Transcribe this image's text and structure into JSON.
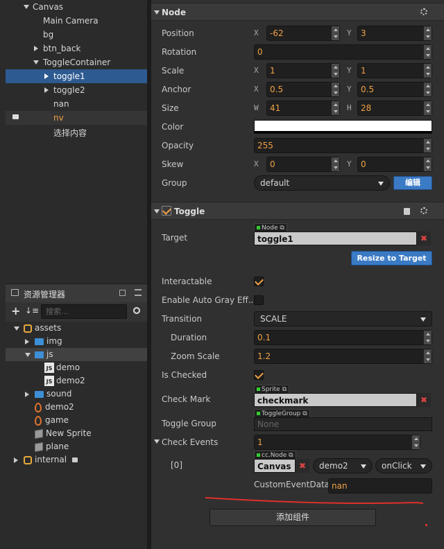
{
  "hierarchy": {
    "nodes": [
      {
        "label": "Canvas",
        "expand": "down"
      },
      {
        "label": "Main Camera",
        "expand": ""
      },
      {
        "label": "bg",
        "expand": ""
      },
      {
        "label": "btn_back",
        "expand": "right"
      },
      {
        "label": "ToggleContainer",
        "expand": "down"
      },
      {
        "label": "toggle1",
        "expand": "right",
        "selected": true
      },
      {
        "label": "toggle2",
        "expand": "right"
      },
      {
        "label": "nan",
        "expand": ""
      },
      {
        "label": "nv",
        "expand": "",
        "locked": true
      },
      {
        "label": "选择内容",
        "expand": ""
      }
    ]
  },
  "assets": {
    "title": "资源管理器",
    "search_placeholder": "搜索...",
    "items": [
      {
        "label": "assets",
        "icon": "package-icon"
      },
      {
        "label": "img",
        "icon": "folder-icon"
      },
      {
        "label": "js",
        "icon": "folder-icon"
      },
      {
        "label": "demo",
        "icon": "js-file-icon"
      },
      {
        "label": "demo2",
        "icon": "js-file-icon"
      },
      {
        "label": "sound",
        "icon": "folder-icon"
      },
      {
        "label": "demo2",
        "icon": "scene-fire-icon"
      },
      {
        "label": "game",
        "icon": "scene-fire-icon"
      },
      {
        "label": "New Sprite",
        "icon": "prefab-cube-icon"
      },
      {
        "label": "plane",
        "icon": "prefab-cube-icon"
      },
      {
        "label": "internal",
        "icon": "package-icon"
      }
    ]
  },
  "node": {
    "title": "Node",
    "position": {
      "label": "Position",
      "x": "-62",
      "y": "3"
    },
    "rotation": {
      "label": "Rotation",
      "value": "0"
    },
    "scale": {
      "label": "Scale",
      "x": "1",
      "y": "1"
    },
    "anchor": {
      "label": "Anchor",
      "x": "0.5",
      "y": "0.5"
    },
    "size": {
      "label": "Size",
      "w": "41",
      "h": "28"
    },
    "color": {
      "label": "Color",
      "value": "#ffffff"
    },
    "opacity": {
      "label": "Opacity",
      "value": "255"
    },
    "skew": {
      "label": "Skew",
      "x": "0",
      "y": "0"
    },
    "group": {
      "label": "Group",
      "value": "default",
      "edit": "编辑"
    },
    "axis": {
      "x": "X",
      "y": "Y",
      "w": "W",
      "h": "H"
    }
  },
  "toggle": {
    "title": "Toggle",
    "target": {
      "label": "Target",
      "tag": "Node",
      "value": "toggle1"
    },
    "resize_button": "Resize to Target",
    "interactable": {
      "label": "Interactable",
      "checked": true
    },
    "auto_gray": {
      "label": "Enable Auto Gray Eff...",
      "checked": false
    },
    "transition": {
      "label": "Transition",
      "value": "SCALE"
    },
    "duration": {
      "label": "Duration",
      "value": "0.1"
    },
    "zoom_scale": {
      "label": "Zoom Scale",
      "value": "1.2"
    },
    "is_checked": {
      "label": "Is Checked",
      "checked": true
    },
    "check_mark": {
      "label": "Check Mark",
      "tag": "Sprite",
      "value": "checkmark"
    },
    "toggle_group": {
      "label": "Toggle Group",
      "tag": "ToggleGroup",
      "placeholder": "None"
    },
    "check_events": {
      "label": "Check Events",
      "count": "1"
    },
    "event0": {
      "index": "[0]",
      "tag": "cc.Node",
      "target": "Canvas",
      "component": "demo2",
      "handler": "onClick"
    },
    "custom_event_data": {
      "label": "CustomEventData",
      "value": "nan"
    }
  },
  "add_component": "添加组件",
  "colors": {
    "accent": "#f0a245",
    "selection": "#2d5a91",
    "annotation": "#e0302a"
  }
}
